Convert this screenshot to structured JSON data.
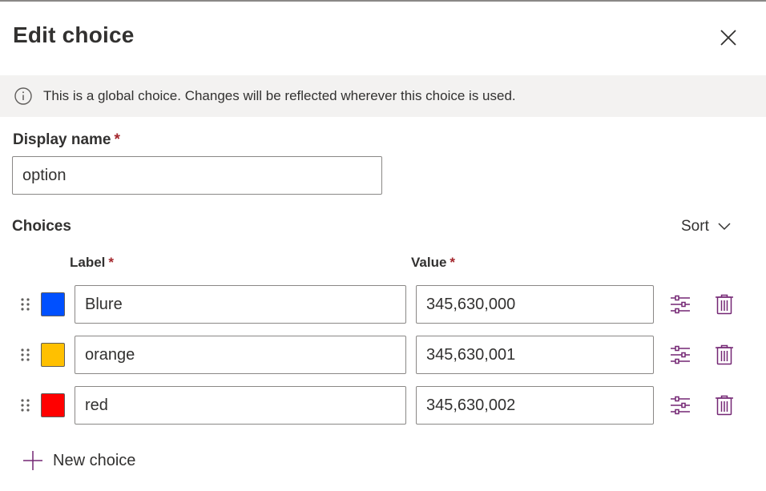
{
  "panel": {
    "title": "Edit choice"
  },
  "banner": {
    "message": "This is a global choice. Changes will be reflected wherever this choice is used."
  },
  "display_name": {
    "label": "Display name",
    "required_mark": "*",
    "value": "option"
  },
  "choices": {
    "section_title": "Choices",
    "sort_label": "Sort",
    "label_header": "Label",
    "value_header": "Value",
    "required_mark": "*",
    "items": [
      {
        "label": "Blure",
        "value": "345,630,000",
        "color": "#0050ff"
      },
      {
        "label": "orange",
        "value": "345,630,001",
        "color": "#ffc000"
      },
      {
        "label": "red",
        "value": "345,630,002",
        "color": "#ff0000"
      }
    ],
    "new_choice_label": "New choice"
  },
  "colors": {
    "accent": "#742774",
    "required": "#a4262c",
    "banner_bg": "#f3f2f1"
  },
  "icons": {
    "close": "close-icon",
    "info": "info-icon",
    "sort": "chevron-down-icon",
    "drag": "drag-handle-icon",
    "settings": "settings-sliders-icon",
    "delete": "trash-icon",
    "add": "plus-icon"
  }
}
